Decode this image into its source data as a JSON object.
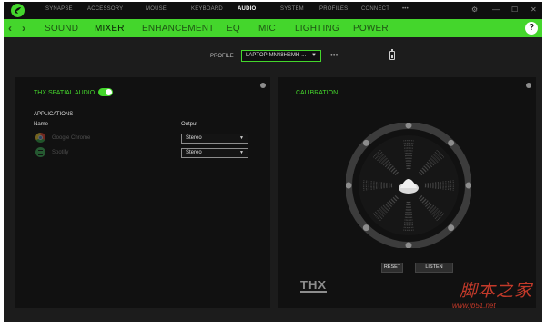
{
  "top_nav": {
    "items": [
      {
        "label": "SYNAPSE",
        "active": false
      },
      {
        "label": "ACCESSORY",
        "active": false
      },
      {
        "label": "MOUSE",
        "active": false
      },
      {
        "label": "KEYBOARD",
        "active": false
      },
      {
        "label": "AUDIO",
        "active": true
      },
      {
        "label": "SYSTEM",
        "active": false
      },
      {
        "label": "PROFILES",
        "active": false
      },
      {
        "label": "CONNECT",
        "active": false
      }
    ],
    "more": "•••",
    "window_controls": {
      "settings": "⚙",
      "minimize": "—",
      "maximize": "☐",
      "close": "✕"
    }
  },
  "sub_nav": {
    "back": "‹",
    "forward": "›",
    "tabs": [
      {
        "label": "SOUND",
        "active": false
      },
      {
        "label": "MIXER",
        "active": true
      },
      {
        "label": "ENHANCEMENT",
        "active": false
      },
      {
        "label": "EQ",
        "active": false
      },
      {
        "label": "MIC",
        "active": false
      },
      {
        "label": "LIGHTING",
        "active": false
      },
      {
        "label": "POWER",
        "active": false
      }
    ],
    "help": "?"
  },
  "profile": {
    "label": "PROFILE",
    "value": "LAPTOP-MN48HSMH-...",
    "more": "•••"
  },
  "mixer": {
    "thx_label": "THX SPATIAL AUDIO",
    "thx_enabled": true,
    "applications_heading": "APPLICATIONS",
    "col_name": "Name",
    "col_output": "Output",
    "apps": [
      {
        "name": "Google Chrome",
        "icon": "chrome-icon",
        "output": "Stereo"
      },
      {
        "name": "Spotify",
        "icon": "spotify-icon",
        "output": "Stereo"
      }
    ]
  },
  "calibration": {
    "label": "CALIBRATION",
    "reset_label": "RESET",
    "listen_label": "LISTEN",
    "speakers": 8,
    "thx_logo": "THX"
  },
  "watermark": {
    "title": "脚本之家",
    "url": "www.jb51.net"
  },
  "colors": {
    "accent": "#44d62c",
    "background": "#1c1c1c",
    "panel": "#111111",
    "watermark": "#c43a2a"
  }
}
